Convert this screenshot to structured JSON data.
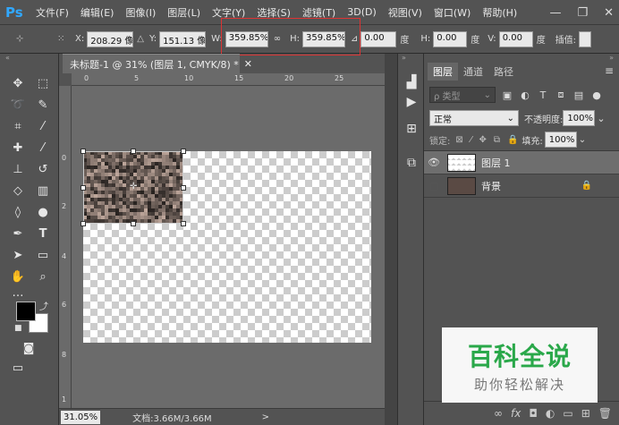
{
  "app": {
    "logo": "Ps"
  },
  "menu": [
    "文件(F)",
    "编辑(E)",
    "图像(I)",
    "图层(L)",
    "文字(Y)",
    "选择(S)",
    "滤镜(T)",
    "3D(D)",
    "视图(V)",
    "窗口(W)",
    "帮助(H)"
  ],
  "window_controls": {
    "minimize": "—",
    "restore": "❐",
    "close": "✕"
  },
  "options": {
    "x_label": "X:",
    "x_value": "208.29 像",
    "y_label": "Y:",
    "y_value": "151.13 像",
    "w_label": "W:",
    "w_value": "359.85%",
    "h_label": "H:",
    "h_value": "359.85%",
    "angle_value": "0.00",
    "angle_unit": "度",
    "hskew_label": "H:",
    "hskew_value": "0.00",
    "hskew_unit": "度",
    "vskew_label": "V:",
    "vskew_value": "0.00",
    "vskew_unit": "度",
    "interp_label": "插值:"
  },
  "document": {
    "tab_title": "未标题-1 @ 31% (图层 1, CMYK/8) *",
    "tab_close": "✕",
    "ruler_top": [
      "0",
      "5",
      "10",
      "15",
      "20",
      "25"
    ],
    "ruler_left": [
      "0",
      "2",
      "4",
      "6",
      "8",
      "1"
    ]
  },
  "status": {
    "zoom": "31.05%",
    "doc_info": "文档:3.66M/3.66M",
    "arrow": ">"
  },
  "panel": {
    "tabs": [
      "图层",
      "通道",
      "路径"
    ],
    "active_tab": 0,
    "filter_placeholder": "ρ 类型",
    "blend_mode": "正常",
    "opacity_label": "不透明度:",
    "opacity_value": "100%",
    "lock_label": "锁定:",
    "fill_label": "填充:",
    "fill_value": "100%",
    "layers": [
      {
        "name": "图层 1",
        "visible": true,
        "selected": true
      },
      {
        "name": "背景",
        "visible": false,
        "selected": false,
        "locked": true
      }
    ]
  },
  "watermark": {
    "title": "百科全说",
    "subtitle": "助你轻松解决"
  },
  "colors": {
    "accent": "#31a8ff",
    "watermark_green": "#2aa84a",
    "highlight_red": "#dd3333"
  }
}
